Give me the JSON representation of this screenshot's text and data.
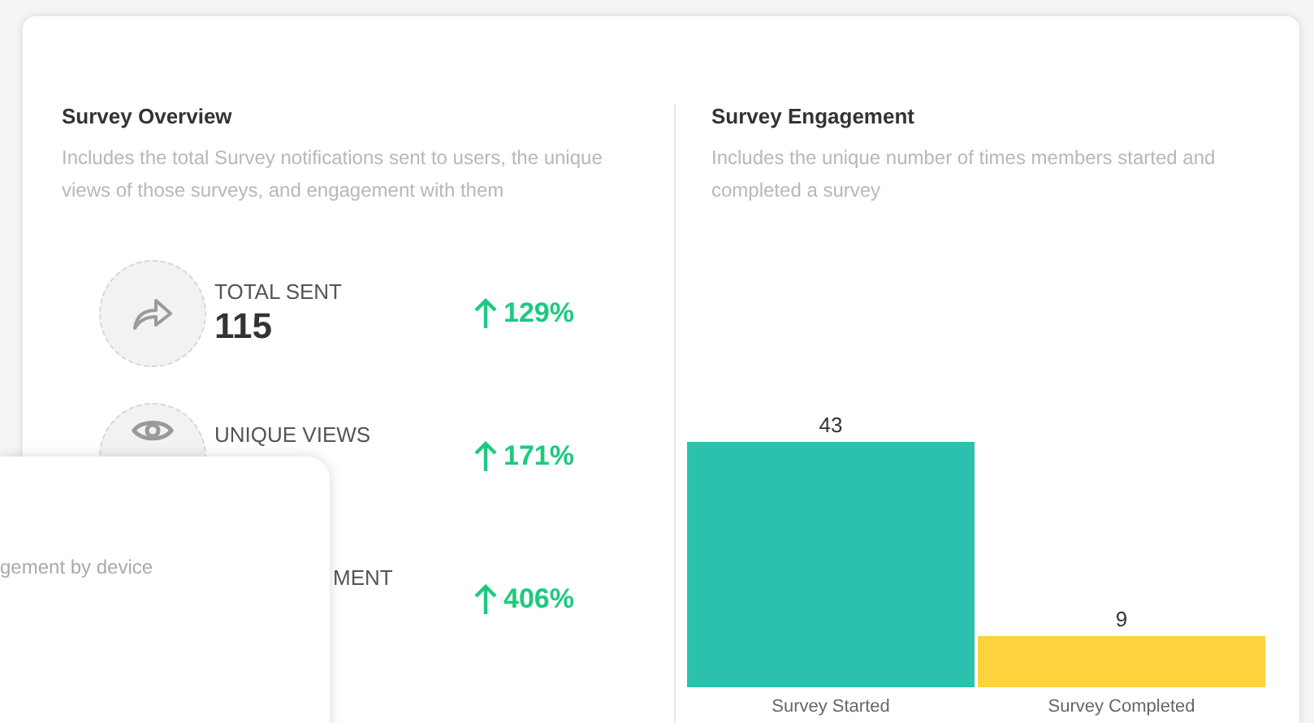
{
  "overview": {
    "title": "Survey Overview",
    "description": "Includes the total Survey notifications sent to users, the unique views of those surveys, and engagement with them",
    "stats": [
      {
        "kind": "share",
        "label": "TOTAL SENT",
        "value": "115",
        "change": "129%"
      },
      {
        "kind": "eye",
        "label": "UNIQUE VIEWS",
        "change": "171%"
      },
      {
        "kind": "hidden",
        "label": "MENT",
        "change": "406%"
      }
    ]
  },
  "engagement": {
    "title": "Survey Engagement",
    "description": "Includes the unique number of times members started and completed a survey",
    "chart_data": {
      "type": "bar",
      "data_labels": true,
      "series": [
        {
          "name": "Survey Started",
          "color": "#2bc1ac",
          "values": [
            43
          ]
        },
        {
          "name": "Survey Completed",
          "color": "#fcd23f",
          "values": [
            9
          ]
        }
      ]
    }
  },
  "device_card": {
    "description": "gement by device"
  }
}
